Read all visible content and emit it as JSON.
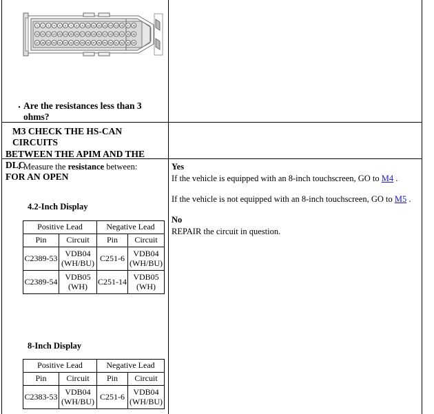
{
  "document": {
    "type": "automotive-diagnostic-pinpoint-test"
  },
  "connector": {
    "name": "electrical-connector-pin-diagram",
    "rows": 3,
    "columns": 18,
    "description": "Multi-pin rectangular electrical connector end view with numbered pin cavities"
  },
  "top_cell": {
    "question": "Are the resistances less than 3 ohms?"
  },
  "step": {
    "id": "M3",
    "title": "M3 CHECK THE HS-CAN CIRCUITS BETWEEN THE APIM AND THE DLC FOR AN OPEN",
    "title_lines": [
      "M3 CHECK THE HS-CAN CIRCUITS",
      "BETWEEN THE APIM AND THE DLC",
      "FOR AN OPEN"
    ],
    "instruction_prefix": "Measure the ",
    "instruction_bold": "resistance",
    "instruction_suffix": " between:"
  },
  "tables": [
    {
      "caption": "4.2-Inch Display",
      "group_headers": [
        "Positive Lead",
        "Negative Lead"
      ],
      "sub_headers": [
        "Pin",
        "Circuit",
        "Pin",
        "Circuit"
      ],
      "rows": [
        [
          "C2389-53",
          "VDB04 (WH/BU)",
          "C251-6",
          "VDB04 (WH/BU)"
        ],
        [
          "C2389-54",
          "VDB05 (WH)",
          "C251-14",
          "VDB05 (WH)"
        ]
      ]
    },
    {
      "caption": "8-Inch Display",
      "group_headers": [
        "Positive Lead",
        "Negative Lead"
      ],
      "sub_headers": [
        "Pin",
        "Circuit",
        "Pin",
        "Circuit"
      ],
      "rows": [
        [
          "C2383-53",
          "VDB04 (WH/BU)",
          "C251-6",
          "VDB04 (WH/BU)"
        ]
      ]
    }
  ],
  "answers": {
    "yes_label": "Yes",
    "yes_line_1_pre": "If the vehicle is equipped with an 8-inch touchscreen, GO to ",
    "yes_line_1_link": "M4",
    "yes_line_1_post": " .",
    "yes_line_2_pre": "If the vehicle is not equipped with an 8-inch touchscreen, GO to ",
    "yes_line_2_link": "M5",
    "yes_line_2_post": " .",
    "no_label": "No",
    "no_text": "REPAIR the circuit in question."
  },
  "colors": {
    "link": "#1818c8",
    "border": "#000000",
    "text": "#000000",
    "connector_fill": "#d9d9d9"
  }
}
